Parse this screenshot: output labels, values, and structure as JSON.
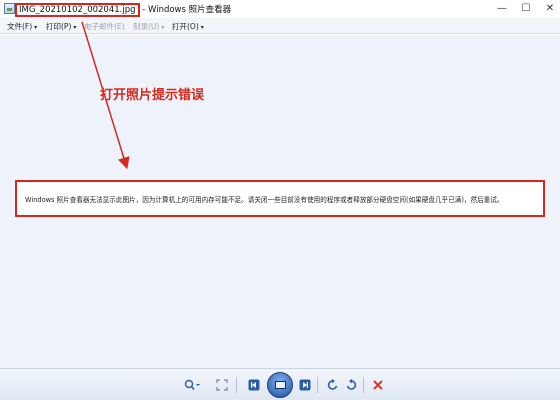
{
  "window": {
    "file_name": "IMG_20210102_002041.jpg",
    "separator": " - ",
    "app_name": "Windows 照片查看器",
    "min_glyph": "—",
    "max_glyph": "☐",
    "close_glyph": "✕"
  },
  "menu": {
    "items": [
      {
        "label": "文件(F)",
        "arrow": "▾",
        "enabled": true
      },
      {
        "label": "打印(P)",
        "arrow": "▾",
        "enabled": true
      },
      {
        "label": "电子邮件(E)",
        "arrow": "",
        "enabled": false
      },
      {
        "label": "刻录(U)",
        "arrow": "▾",
        "enabled": false
      },
      {
        "label": "打开(O)",
        "arrow": "▾",
        "enabled": true
      }
    ]
  },
  "annotation": {
    "text": "打开照片提示错误",
    "color": "#d42a1e"
  },
  "error": {
    "message": "Windows 照片查看器无法显示此图片，因为计算机上的可用内存可能不足。请关闭一些目前没有使用的程序或者释放部分硬盘空间(如果硬盘几乎已满)，然后重试。"
  },
  "toolbar": {
    "zoom_icon": "search-zoom-icon",
    "fit_icon": "actual-size-icon",
    "prev_icon": "previous-icon",
    "slideshow_icon": "slideshow-icon",
    "next_icon": "next-icon",
    "rotate_ccw_icon": "rotate-counterclockwise-icon",
    "rotate_cw_icon": "rotate-clockwise-icon",
    "delete_icon": "delete-icon"
  },
  "colors": {
    "highlight_red": "#d9261c",
    "viewer_background": "#eef2fa",
    "toolbar_blue": "#2a5da8"
  }
}
